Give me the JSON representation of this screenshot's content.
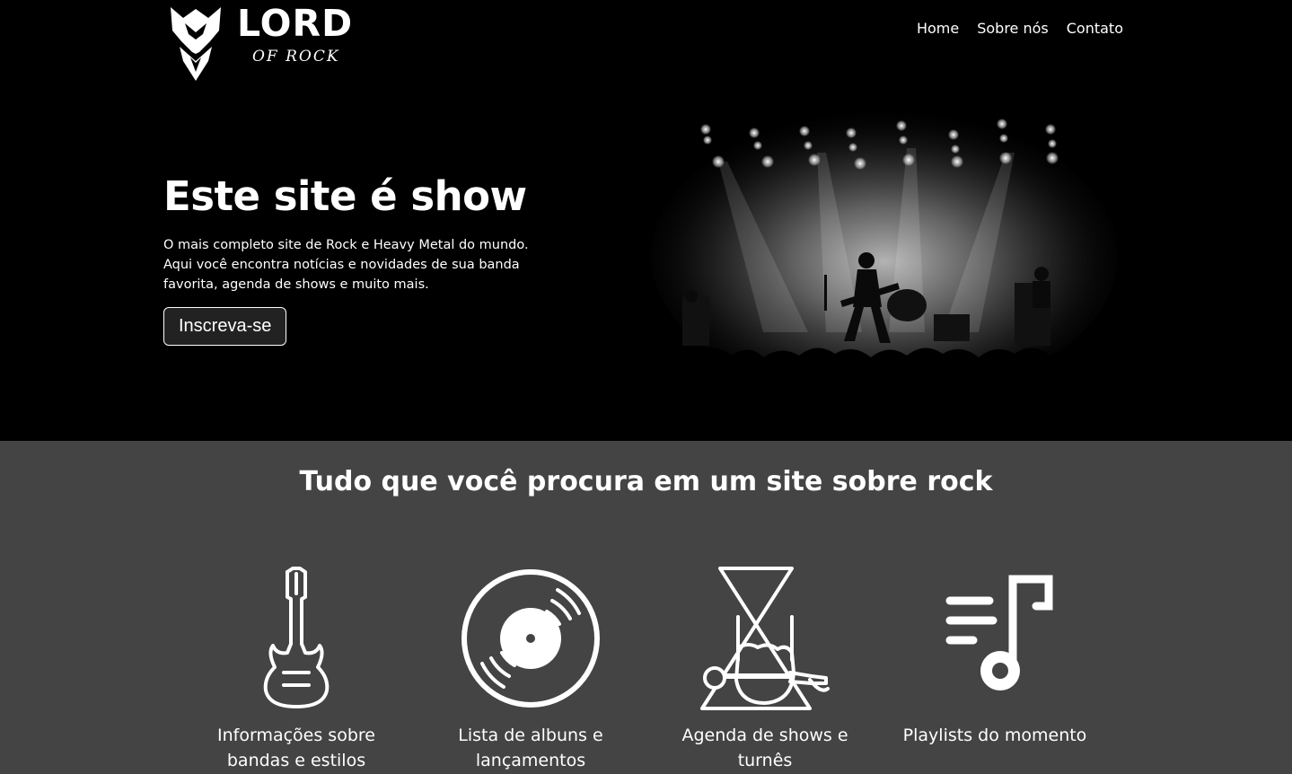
{
  "brand": {
    "name_main": "LORD",
    "name_sub": "OF ROCK"
  },
  "nav": [
    {
      "label": "Home"
    },
    {
      "label": "Sobre nós"
    },
    {
      "label": "Contato"
    }
  ],
  "hero": {
    "title": "Este site é show",
    "description": "O mais completo site de Rock e Heavy Metal do mundo. Aqui você encontra notícias e novidades de sua banda favorita, agenda de shows e muito mais.",
    "cta_label": "Inscreva-se"
  },
  "features": {
    "title": "Tudo que você procura em um site sobre rock",
    "items": [
      {
        "label": "Informações sobre bandas e estilos",
        "icon": "guitar-icon"
      },
      {
        "label": "Lista de albuns e lançamentos",
        "icon": "vinyl-record-icon"
      },
      {
        "label": "Agenda de shows e turnês",
        "icon": "rock-hand-microphone-icon"
      },
      {
        "label": "Playlists do momento",
        "icon": "playlist-music-note-icon"
      }
    ]
  },
  "colors": {
    "hero_bg": "#000000",
    "features_bg": "#444444",
    "text": "#ffffff"
  }
}
